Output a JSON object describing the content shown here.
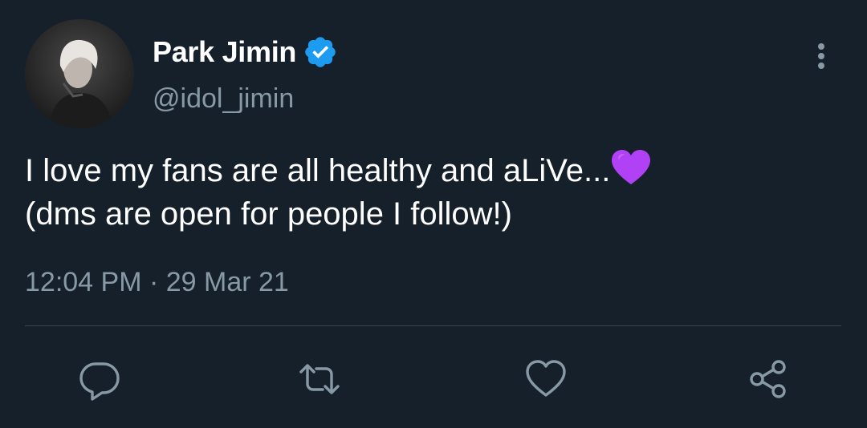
{
  "tweet": {
    "display_name": "Park Jimin",
    "verified": true,
    "handle": "@idol_jimin",
    "text_line_1": "I love my fans are all healthy and aLiVe...",
    "text_line_2": "(dms are open for people I follow!)",
    "emoji": "purple-heart",
    "timestamp": "12:04 PM · 29 Mar 21"
  },
  "icons": {
    "more": "more-vertical-icon",
    "reply": "reply-icon",
    "retweet": "retweet-icon",
    "like": "like-icon",
    "share": "share-icon"
  },
  "colors": {
    "background": "#15202b",
    "primary_text": "#ffffff",
    "secondary_text": "#8899a6",
    "divider": "#38444d",
    "verified_blue": "#1d9bf0",
    "emoji_purple": "#b041f5"
  }
}
